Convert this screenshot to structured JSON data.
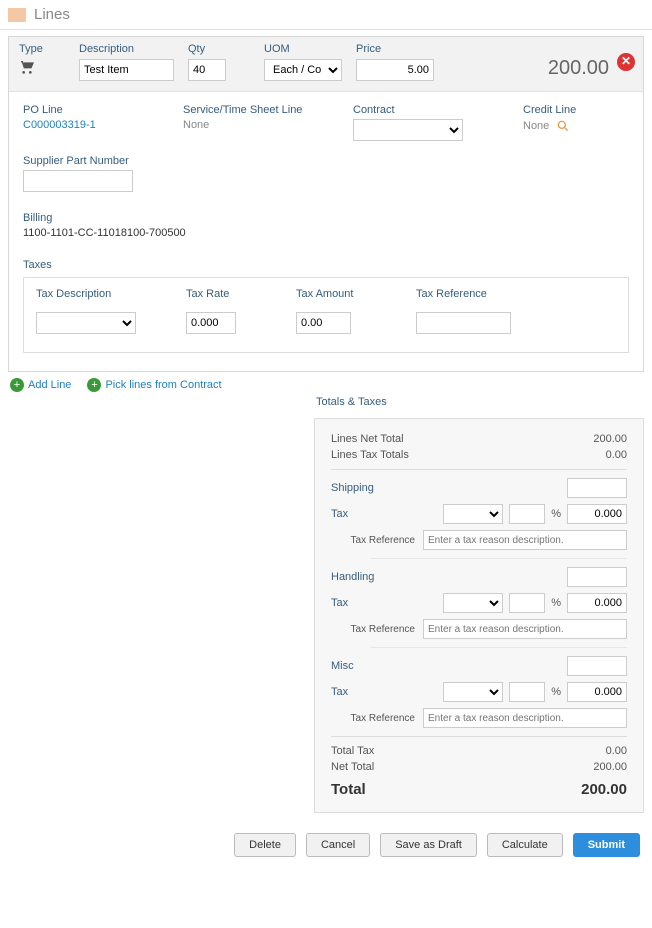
{
  "section_title": "Lines",
  "header": {
    "type_label": "Type",
    "description_label": "Description",
    "description_value": "Test Item",
    "qty_label": "Qty",
    "qty_value": "40",
    "uom_label": "UOM",
    "uom_value": "Each / Count",
    "price_label": "Price",
    "price_value": "5.00",
    "line_total": "200.00"
  },
  "details": {
    "po_line_label": "PO Line",
    "po_line_value": "C000003319-1",
    "service_line_label": "Service/Time Sheet Line",
    "service_line_value": "None",
    "contract_label": "Contract",
    "credit_line_label": "Credit Line",
    "credit_line_value": "None",
    "supplier_part_label": "Supplier Part Number",
    "billing_label": "Billing",
    "billing_value": "1100-1101-CC-11018100-700500",
    "taxes_label": "Taxes",
    "tax_description_label": "Tax Description",
    "tax_rate_label": "Tax Rate",
    "tax_rate_value": "0.000",
    "tax_amount_label": "Tax Amount",
    "tax_amount_value": "0.00",
    "tax_reference_label": "Tax Reference"
  },
  "actions": {
    "add_line": "Add Line",
    "pick_lines": "Pick lines from Contract"
  },
  "totals": {
    "title": "Totals & Taxes",
    "lines_net_total_label": "Lines Net Total",
    "lines_net_total_value": "200.00",
    "lines_tax_totals_label": "Lines Tax Totals",
    "lines_tax_totals_value": "0.00",
    "shipping_label": "Shipping",
    "handling_label": "Handling",
    "misc_label": "Misc",
    "tax_label": "Tax",
    "percent_label": "%",
    "tax_value": "0.000",
    "tax_reference_label": "Tax Reference",
    "tax_reference_placeholder": "Enter a tax reason description.",
    "total_tax_label": "Total Tax",
    "total_tax_value": "0.00",
    "net_total_label": "Net Total",
    "net_total_value": "200.00",
    "total_label": "Total",
    "total_value": "200.00"
  },
  "buttons": {
    "delete": "Delete",
    "cancel": "Cancel",
    "save_draft": "Save as Draft",
    "calculate": "Calculate",
    "submit": "Submit"
  }
}
